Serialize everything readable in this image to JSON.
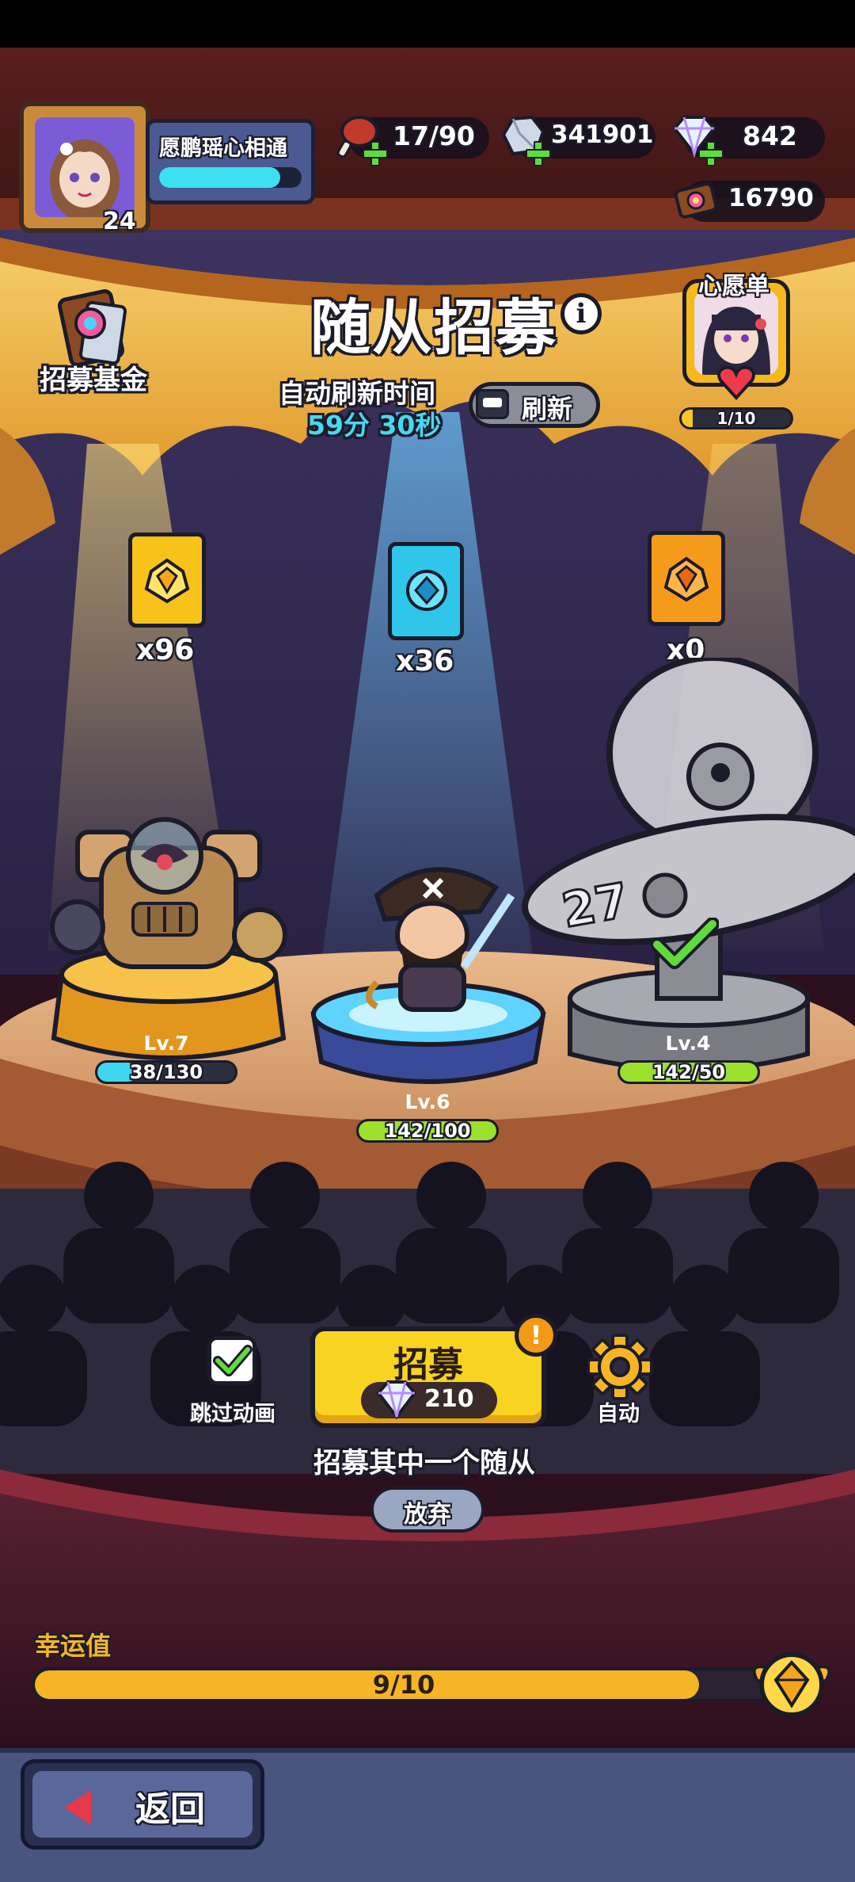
{
  "player": {
    "name": "愿鹏瑶心相通",
    "level": "24",
    "exp_fraction": 0.85
  },
  "resources": {
    "stamina": "17/90",
    "stone": "341901",
    "diamond": "842",
    "token": "16790"
  },
  "left_feature": {
    "label": "招募基金",
    "icon": "recruit-fund-icon"
  },
  "title": "随从招募",
  "refresh": {
    "label": "自动刷新时间",
    "timer": "59分 30秒",
    "button_label": "刷新"
  },
  "wishlist": {
    "label": "心愿单",
    "progress_text": "1/10",
    "progress_fraction": 0.1
  },
  "cards": [
    {
      "icon": "gold-crest-card-icon",
      "count": "x96",
      "color": "#f7c21a"
    },
    {
      "icon": "blue-gem-card-icon",
      "count": "x36",
      "color": "#2fc6ea"
    },
    {
      "icon": "orange-crest-card-icon",
      "count": "x0",
      "color": "#f59a1b"
    }
  ],
  "followers": [
    {
      "name": "golem-robot",
      "level": "Lv.7",
      "exp_text": "38/130",
      "exp_fraction": 0.29,
      "bar_color": "#3fd6ef"
    },
    {
      "name": "pirate-swordsman",
      "level": "Lv.6",
      "exp_text": "142/100",
      "exp_fraction": 1.0,
      "bar_color": "#9be02c"
    },
    {
      "name": "ufo-pilot",
      "level": "Lv.4",
      "exp_text": "142/50",
      "exp_fraction": 1.0,
      "bar_color": "#9be02c"
    }
  ],
  "controls": {
    "skip_label": "跳过动画",
    "recruit_label": "招募",
    "recruit_cost": "210",
    "alert_mark": "!",
    "auto_label": "自动",
    "hint": "招募其中一个随从",
    "give_up_label": "放弃"
  },
  "luck": {
    "label": "幸运值",
    "text": "9/10",
    "fraction": 0.9
  },
  "back_label": "返回",
  "info_mark": "i"
}
